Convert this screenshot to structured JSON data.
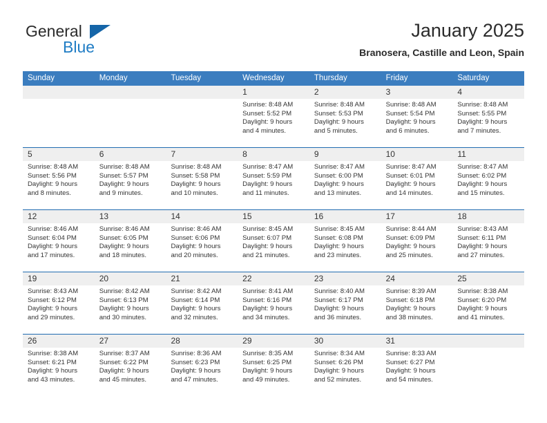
{
  "brand": {
    "word1": "General",
    "word2": "Blue",
    "triangle_color": "#1565a8",
    "blue_text_color": "#1f7cc4"
  },
  "header": {
    "title": "January 2025",
    "subtitle": "Branosera, Castille and Leon, Spain"
  },
  "theme": {
    "header_row_bg": "#3b7dbf",
    "header_row_text": "#ffffff",
    "daynum_band_bg": "#efefef",
    "week_divider": "#1f6bb0",
    "cell_text": "#333333"
  },
  "weekdays": [
    "Sunday",
    "Monday",
    "Tuesday",
    "Wednesday",
    "Thursday",
    "Friday",
    "Saturday"
  ],
  "weeks": [
    [
      {
        "day": "",
        "lines": []
      },
      {
        "day": "",
        "lines": []
      },
      {
        "day": "",
        "lines": []
      },
      {
        "day": "1",
        "lines": [
          "Sunrise: 8:48 AM",
          "Sunset: 5:52 PM",
          "Daylight: 9 hours",
          "and 4 minutes."
        ]
      },
      {
        "day": "2",
        "lines": [
          "Sunrise: 8:48 AM",
          "Sunset: 5:53 PM",
          "Daylight: 9 hours",
          "and 5 minutes."
        ]
      },
      {
        "day": "3",
        "lines": [
          "Sunrise: 8:48 AM",
          "Sunset: 5:54 PM",
          "Daylight: 9 hours",
          "and 6 minutes."
        ]
      },
      {
        "day": "4",
        "lines": [
          "Sunrise: 8:48 AM",
          "Sunset: 5:55 PM",
          "Daylight: 9 hours",
          "and 7 minutes."
        ]
      }
    ],
    [
      {
        "day": "5",
        "lines": [
          "Sunrise: 8:48 AM",
          "Sunset: 5:56 PM",
          "Daylight: 9 hours",
          "and 8 minutes."
        ]
      },
      {
        "day": "6",
        "lines": [
          "Sunrise: 8:48 AM",
          "Sunset: 5:57 PM",
          "Daylight: 9 hours",
          "and 9 minutes."
        ]
      },
      {
        "day": "7",
        "lines": [
          "Sunrise: 8:48 AM",
          "Sunset: 5:58 PM",
          "Daylight: 9 hours",
          "and 10 minutes."
        ]
      },
      {
        "day": "8",
        "lines": [
          "Sunrise: 8:47 AM",
          "Sunset: 5:59 PM",
          "Daylight: 9 hours",
          "and 11 minutes."
        ]
      },
      {
        "day": "9",
        "lines": [
          "Sunrise: 8:47 AM",
          "Sunset: 6:00 PM",
          "Daylight: 9 hours",
          "and 13 minutes."
        ]
      },
      {
        "day": "10",
        "lines": [
          "Sunrise: 8:47 AM",
          "Sunset: 6:01 PM",
          "Daylight: 9 hours",
          "and 14 minutes."
        ]
      },
      {
        "day": "11",
        "lines": [
          "Sunrise: 8:47 AM",
          "Sunset: 6:02 PM",
          "Daylight: 9 hours",
          "and 15 minutes."
        ]
      }
    ],
    [
      {
        "day": "12",
        "lines": [
          "Sunrise: 8:46 AM",
          "Sunset: 6:04 PM",
          "Daylight: 9 hours",
          "and 17 minutes."
        ]
      },
      {
        "day": "13",
        "lines": [
          "Sunrise: 8:46 AM",
          "Sunset: 6:05 PM",
          "Daylight: 9 hours",
          "and 18 minutes."
        ]
      },
      {
        "day": "14",
        "lines": [
          "Sunrise: 8:46 AM",
          "Sunset: 6:06 PM",
          "Daylight: 9 hours",
          "and 20 minutes."
        ]
      },
      {
        "day": "15",
        "lines": [
          "Sunrise: 8:45 AM",
          "Sunset: 6:07 PM",
          "Daylight: 9 hours",
          "and 21 minutes."
        ]
      },
      {
        "day": "16",
        "lines": [
          "Sunrise: 8:45 AM",
          "Sunset: 6:08 PM",
          "Daylight: 9 hours",
          "and 23 minutes."
        ]
      },
      {
        "day": "17",
        "lines": [
          "Sunrise: 8:44 AM",
          "Sunset: 6:09 PM",
          "Daylight: 9 hours",
          "and 25 minutes."
        ]
      },
      {
        "day": "18",
        "lines": [
          "Sunrise: 8:43 AM",
          "Sunset: 6:11 PM",
          "Daylight: 9 hours",
          "and 27 minutes."
        ]
      }
    ],
    [
      {
        "day": "19",
        "lines": [
          "Sunrise: 8:43 AM",
          "Sunset: 6:12 PM",
          "Daylight: 9 hours",
          "and 29 minutes."
        ]
      },
      {
        "day": "20",
        "lines": [
          "Sunrise: 8:42 AM",
          "Sunset: 6:13 PM",
          "Daylight: 9 hours",
          "and 30 minutes."
        ]
      },
      {
        "day": "21",
        "lines": [
          "Sunrise: 8:42 AM",
          "Sunset: 6:14 PM",
          "Daylight: 9 hours",
          "and 32 minutes."
        ]
      },
      {
        "day": "22",
        "lines": [
          "Sunrise: 8:41 AM",
          "Sunset: 6:16 PM",
          "Daylight: 9 hours",
          "and 34 minutes."
        ]
      },
      {
        "day": "23",
        "lines": [
          "Sunrise: 8:40 AM",
          "Sunset: 6:17 PM",
          "Daylight: 9 hours",
          "and 36 minutes."
        ]
      },
      {
        "day": "24",
        "lines": [
          "Sunrise: 8:39 AM",
          "Sunset: 6:18 PM",
          "Daylight: 9 hours",
          "and 38 minutes."
        ]
      },
      {
        "day": "25",
        "lines": [
          "Sunrise: 8:38 AM",
          "Sunset: 6:20 PM",
          "Daylight: 9 hours",
          "and 41 minutes."
        ]
      }
    ],
    [
      {
        "day": "26",
        "lines": [
          "Sunrise: 8:38 AM",
          "Sunset: 6:21 PM",
          "Daylight: 9 hours",
          "and 43 minutes."
        ]
      },
      {
        "day": "27",
        "lines": [
          "Sunrise: 8:37 AM",
          "Sunset: 6:22 PM",
          "Daylight: 9 hours",
          "and 45 minutes."
        ]
      },
      {
        "day": "28",
        "lines": [
          "Sunrise: 8:36 AM",
          "Sunset: 6:23 PM",
          "Daylight: 9 hours",
          "and 47 minutes."
        ]
      },
      {
        "day": "29",
        "lines": [
          "Sunrise: 8:35 AM",
          "Sunset: 6:25 PM",
          "Daylight: 9 hours",
          "and 49 minutes."
        ]
      },
      {
        "day": "30",
        "lines": [
          "Sunrise: 8:34 AM",
          "Sunset: 6:26 PM",
          "Daylight: 9 hours",
          "and 52 minutes."
        ]
      },
      {
        "day": "31",
        "lines": [
          "Sunrise: 8:33 AM",
          "Sunset: 6:27 PM",
          "Daylight: 9 hours",
          "and 54 minutes."
        ]
      },
      {
        "day": "",
        "lines": []
      }
    ]
  ]
}
